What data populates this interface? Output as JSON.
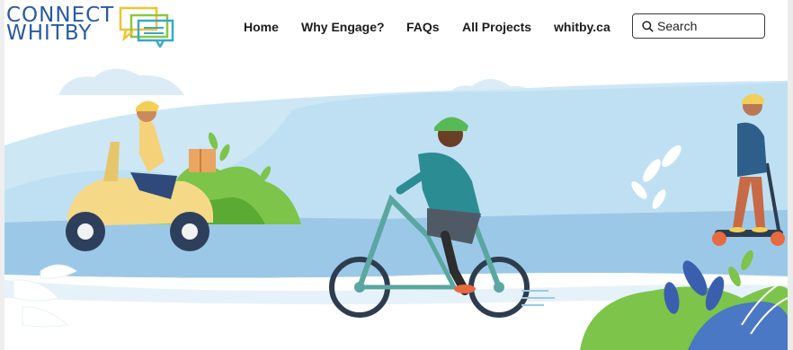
{
  "logo": {
    "line1": "CONNECT",
    "line2": "WHITBY"
  },
  "nav": {
    "home": "Home",
    "why": "Why Engage?",
    "faqs": "FAQs",
    "all_projects": "All Projects",
    "whitby": "whitby.ca"
  },
  "search": {
    "placeholder": "Search",
    "icon": "search-icon"
  },
  "colors": {
    "brand_blue": "#2a5aa0",
    "logo_green": "#8cc63f",
    "logo_yellow": "#f2c230",
    "logo_teal": "#36a9c9",
    "sky": "#cde7f5",
    "road": "#9cc8e8"
  },
  "hero": {
    "riders": [
      "scooter-rider",
      "cyclist",
      "e-scooter-rider"
    ]
  }
}
